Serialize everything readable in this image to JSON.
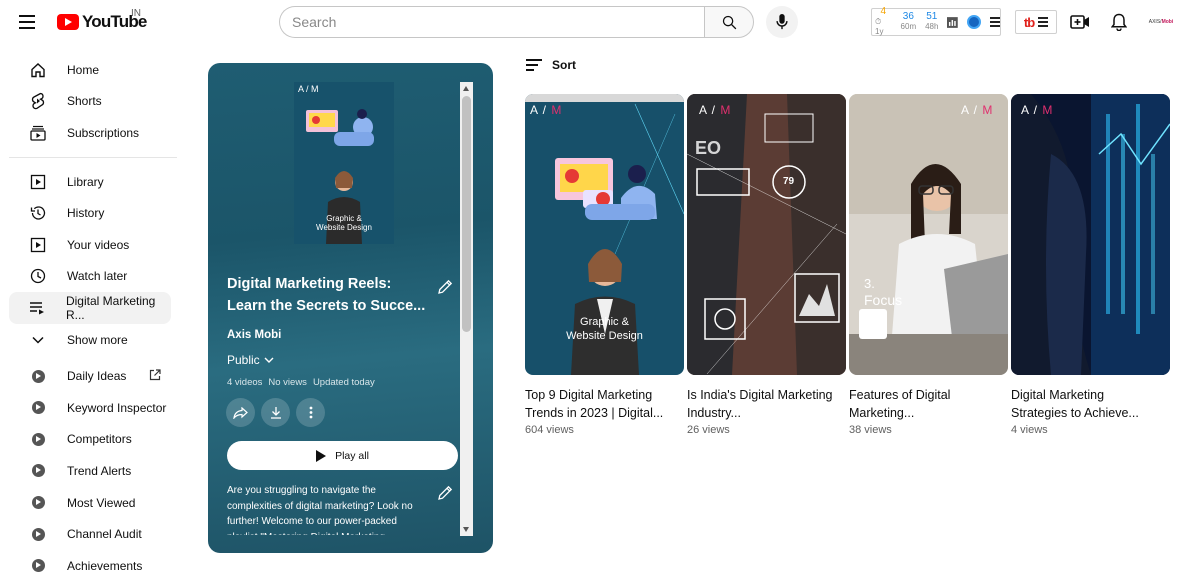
{
  "header": {
    "logo_text": "YouTube",
    "country_code": "IN",
    "search_placeholder": "Search",
    "extension_stats": [
      {
        "value": "4",
        "label": "1y",
        "color": "#f5a300"
      },
      {
        "value": "36",
        "label": "60m",
        "color": "#1e88e5"
      },
      {
        "value": "51",
        "label": "48h",
        "color": "#1e88e5"
      }
    ],
    "avatar_text_a": "AXIS",
    "avatar_text_b": "Mobi"
  },
  "sidebar": {
    "primary": [
      {
        "label": "Home",
        "icon": "home-icon"
      },
      {
        "label": "Shorts",
        "icon": "shorts-icon"
      },
      {
        "label": "Subscriptions",
        "icon": "subscriptions-icon"
      }
    ],
    "secondary": [
      {
        "label": "Library",
        "icon": "library-icon"
      },
      {
        "label": "History",
        "icon": "history-icon"
      },
      {
        "label": "Your videos",
        "icon": "your-videos-icon"
      },
      {
        "label": "Watch later",
        "icon": "watch-later-icon"
      },
      {
        "label": "Digital Marketing R...",
        "icon": "playlist-icon",
        "active": true
      },
      {
        "label": "Show more",
        "icon": "chevron-down-icon"
      }
    ],
    "channel_items": [
      {
        "label": "Daily Ideas",
        "external": true
      },
      {
        "label": "Keyword Inspector"
      },
      {
        "label": "Competitors"
      },
      {
        "label": "Trend Alerts"
      },
      {
        "label": "Most Viewed"
      },
      {
        "label": "Channel Audit"
      },
      {
        "label": "Achievements"
      }
    ]
  },
  "playlist": {
    "thumb_caption_line1": "Graphic &",
    "thumb_caption_line2": "Website Design",
    "thumb_brand": "A / M",
    "title_line1": "Digital Marketing Reels:",
    "title_line2": "Learn the Secrets to Succe...",
    "owner": "Axis Mobi",
    "privacy": "Public",
    "video_count": "4 videos",
    "views": "No views",
    "updated": "Updated today",
    "play_all_label": "Play all",
    "description": "Are you struggling to navigate the complexities of digital marketing? Look no further! Welcome to our power-packed playlist \"Mastering Digital Marketing"
  },
  "main": {
    "sort_label": "Sort",
    "videos": [
      {
        "title": "Top 9 Digital Marketing Trends in 2023 | Digital...",
        "views": "604 views",
        "brand": "A / M",
        "caption_line1": "Graphic &",
        "caption_line2": "Website Design"
      },
      {
        "title": "Is India's Digital Marketing Industry...",
        "views": "26 views",
        "brand": "A / M",
        "overlay": "79"
      },
      {
        "title": "Features of Digital Marketing...",
        "views": "38 views",
        "brand": "A / M",
        "overlay_num": "3.",
        "overlay": "Focus"
      },
      {
        "title": "Digital Marketing Strategies to Achieve...",
        "views": "4 views",
        "brand": "A / M"
      }
    ]
  }
}
